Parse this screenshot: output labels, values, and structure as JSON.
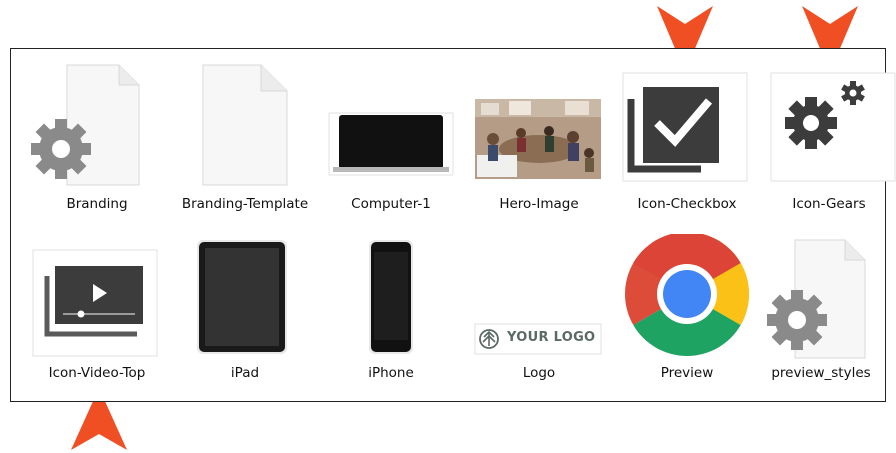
{
  "files": [
    {
      "name": "Branding"
    },
    {
      "name": "Branding-Template"
    },
    {
      "name": "Computer-1"
    },
    {
      "name": "Hero-Image"
    },
    {
      "name": "Icon-Checkbox"
    },
    {
      "name": "Icon-Gears"
    },
    {
      "name": "Icon-Video-Top"
    },
    {
      "name": "iPad"
    },
    {
      "name": "iPhone"
    },
    {
      "name": "Logo"
    },
    {
      "name": "Preview"
    },
    {
      "name": "preview_styles"
    }
  ],
  "logo_text": "YOUR LOGO",
  "colors": {
    "arrow": "#f04e23",
    "dark_icon": "#3c3c3c",
    "gear": "#8a8a8a"
  }
}
